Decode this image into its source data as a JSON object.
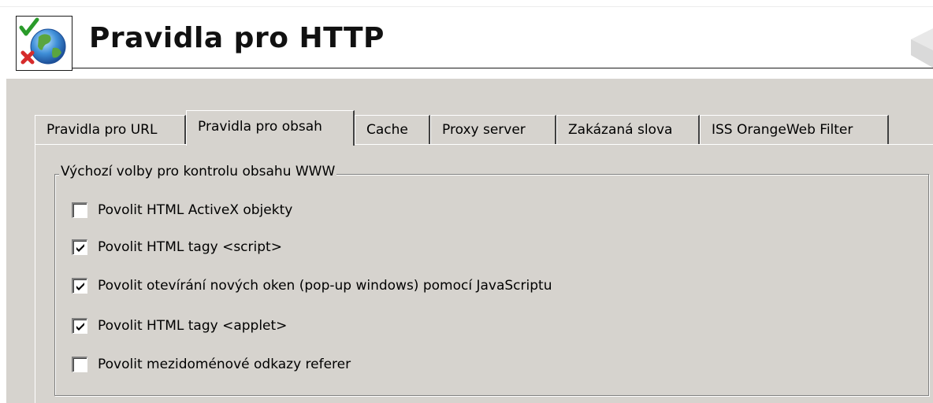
{
  "header": {
    "title": "Pravidla pro HTTP",
    "icon": "globe-check-icon"
  },
  "tabs": [
    {
      "label": "Pravidla pro URL",
      "active": false
    },
    {
      "label": "Pravidla pro obsah",
      "active": true
    },
    {
      "label": "Cache",
      "active": false
    },
    {
      "label": "Proxy server",
      "active": false
    },
    {
      "label": "Zakázaná slova",
      "active": false
    },
    {
      "label": "ISS OrangeWeb Filter",
      "active": false
    }
  ],
  "group": {
    "legend": "Výchozí volby pro kontrolu obsahu WWW",
    "options": [
      {
        "label": "Povolit HTML ActiveX objekty",
        "checked": false
      },
      {
        "label": "Povolit HTML tagy <script>",
        "checked": true
      },
      {
        "label": "Povolit otevírání nových oken (pop-up windows) pomocí JavaScriptu",
        "checked": true
      },
      {
        "label": "Povolit HTML tagy <applet>",
        "checked": true
      },
      {
        "label": "Povolit mezidoménové odkazy referer",
        "checked": false
      }
    ]
  }
}
